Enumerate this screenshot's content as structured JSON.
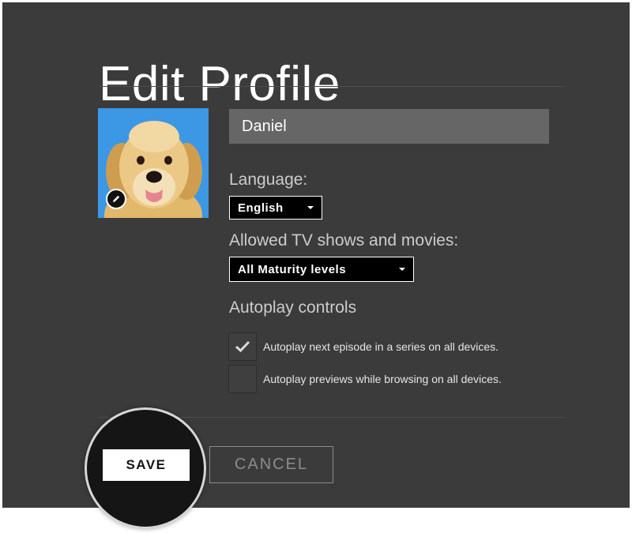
{
  "page": {
    "title": "Edit Profile"
  },
  "profile": {
    "name_value": "Daniel",
    "avatar_icon": "dog-avatar",
    "edit_icon": "pencil-icon"
  },
  "language": {
    "label": "Language:",
    "selected": "English"
  },
  "maturity": {
    "label": "Allowed TV shows and movies:",
    "selected": "All Maturity levels"
  },
  "autoplay": {
    "heading": "Autoplay controls",
    "options": [
      {
        "label": "Autoplay next episode in a series on all devices.",
        "checked": true
      },
      {
        "label": "Autoplay previews while browsing on all devices.",
        "checked": false
      }
    ]
  },
  "actions": {
    "save_label": "SAVE",
    "cancel_label": "CANCEL"
  },
  "colors": {
    "panel": "#3b3b3b",
    "input": "#666666",
    "text": "#ffffff",
    "highlight_ring": "#d6d6d6"
  }
}
